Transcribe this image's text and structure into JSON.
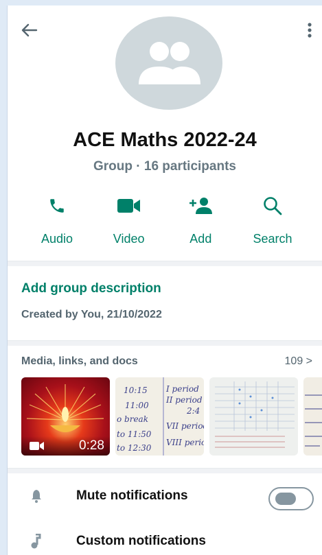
{
  "header": {
    "title": "ACE Maths 2022-24",
    "subtitle": "Group · 16 participants"
  },
  "actions": [
    {
      "label": "Audio",
      "icon": "phone-icon"
    },
    {
      "label": "Video",
      "icon": "video-icon"
    },
    {
      "label": "Add",
      "icon": "add-person-icon"
    },
    {
      "label": "Search",
      "icon": "search-icon"
    }
  ],
  "description": {
    "add_label": "Add group description",
    "created": "Created by You, 21/10/2022"
  },
  "media": {
    "title": "Media, links, and docs",
    "count": "109 >",
    "video_duration": "0:28",
    "notes": [
      "10:15",
      "11:00",
      "o break",
      "to 11:50",
      "to 12:30"
    ],
    "notes_right": [
      "I period",
      "II period",
      "2:4",
      "VII period",
      "VIII perio"
    ]
  },
  "settings": {
    "mute_label": "Mute notifications",
    "mute_on": false,
    "custom_label": "Custom notifications"
  },
  "colors": {
    "accent": "#008069",
    "avatar_bg": "#cfd8dc",
    "muted_text": "#54656f"
  }
}
